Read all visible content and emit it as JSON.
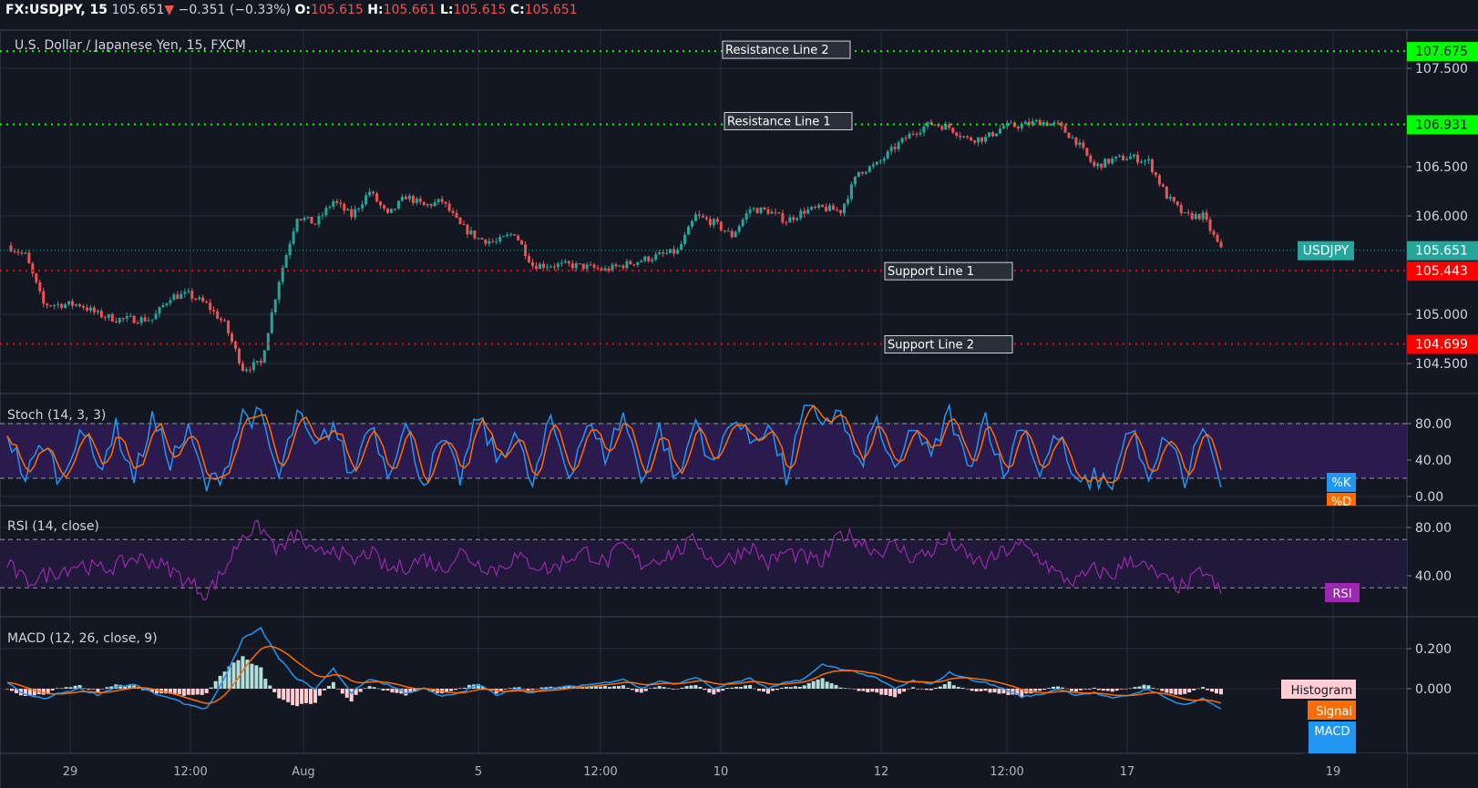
{
  "header": {
    "symbol": "FX:USDJPY, 15",
    "last": "105.651",
    "arrow": "▼",
    "change": "−0.351 (−0.33%)",
    "o_label": "O:",
    "o": "105.615",
    "h_label": "H:",
    "h": "105.661",
    "l_label": "L:",
    "l": "105.615",
    "c_label": "C:",
    "c": "105.651"
  },
  "colors": {
    "bg": "#131722",
    "grid": "#2a2e39",
    "up": "#26a69a",
    "down": "#ef5350",
    "resistance": "#00ff00",
    "support": "#ff0000",
    "k": "#2196f3",
    "d": "#ff6d00",
    "rsi": "#9c27b0"
  },
  "chart_data": {
    "type": "candlestick",
    "title": "U.S. Dollar / Japanese Yen, 15, FXCM",
    "x_ticks": [
      "29",
      "12:00",
      "Aug",
      "5",
      "12:00",
      "10",
      "12",
      "12:00",
      "17",
      "19"
    ],
    "price": {
      "yticks": [
        "107.500",
        "106.500",
        "106.000",
        "105.000",
        "104.500"
      ],
      "ytick_values": [
        107.5,
        106.5,
        106.0,
        105.0,
        104.5
      ],
      "ylim": [
        104.2,
        107.75
      ],
      "closes": [
        105.7,
        105.6,
        105.1,
        105.1,
        105.1,
        105.0,
        104.95,
        104.95,
        104.95,
        105.18,
        105.2,
        105.1,
        104.9,
        104.45,
        104.5,
        105.35,
        106.0,
        105.92,
        106.15,
        106.0,
        106.25,
        106.0,
        106.2,
        106.1,
        106.15,
        105.9,
        105.77,
        105.73,
        105.83,
        105.5,
        105.5,
        105.5,
        105.48,
        105.45,
        105.5,
        105.55,
        105.6,
        105.64,
        106.0,
        105.93,
        105.8,
        106.07,
        106.05,
        105.95,
        106.05,
        106.08,
        106.05,
        106.45,
        106.52,
        106.7,
        106.85,
        106.94,
        106.9,
        106.78,
        106.79,
        106.91,
        106.92,
        106.96,
        106.92,
        106.76,
        106.5,
        106.57,
        106.6,
        106.55,
        106.2,
        106.0,
        106.0,
        105.65
      ],
      "last_label": "USDJPY",
      "last_value": 105.651,
      "last_text": "105.651",
      "lines": [
        {
          "name": "Resistance Line 2",
          "value": 107.675,
          "text": "107.675",
          "kind": "resistance"
        },
        {
          "name": "Resistance Line 1",
          "value": 106.931,
          "text": "106.931",
          "kind": "resistance"
        },
        {
          "name": "Support Line 1",
          "value": 105.443,
          "text": "105.443",
          "kind": "support"
        },
        {
          "name": "Support Line 2",
          "value": 104.699,
          "text": "104.699",
          "kind": "support"
        }
      ]
    },
    "stoch": {
      "title": "Stoch (14, 3, 3)",
      "yticks": [
        "80.00",
        "40.00",
        "0.00"
      ],
      "ytick_values": [
        80,
        40,
        0
      ],
      "band": [
        20,
        80
      ],
      "k_label": "%K",
      "d_label": "%D",
      "k": [
        70,
        20,
        60,
        15,
        80,
        30,
        75,
        20,
        85,
        40,
        70,
        10,
        30,
        90,
        85,
        20,
        90,
        50,
        80,
        20,
        85,
        30,
        75,
        15,
        60,
        20,
        90,
        40,
        70,
        10,
        85,
        25,
        80,
        45,
        90,
        20,
        75,
        15,
        85,
        30,
        90,
        60,
        80,
        20,
        95,
        85,
        90,
        30,
        85,
        20,
        80,
        40,
        95,
        30,
        90,
        20,
        85,
        25,
        70,
        10,
        20,
        15,
        80,
        10,
        70,
        15,
        80,
        10
      ]
    },
    "rsi": {
      "title": "RSI (14, close)",
      "yticks": [
        "80.00",
        "40.00"
      ],
      "ytick_values": [
        80,
        40
      ],
      "band": [
        30,
        70
      ],
      "label": "RSI",
      "values": [
        50,
        35,
        40,
        45,
        50,
        45,
        48,
        55,
        52,
        45,
        35,
        25,
        45,
        75,
        80,
        60,
        75,
        55,
        65,
        50,
        60,
        45,
        48,
        55,
        45,
        60,
        50,
        45,
        55,
        50,
        45,
        55,
        60,
        50,
        65,
        50,
        55,
        60,
        70,
        50,
        55,
        65,
        50,
        60,
        55,
        50,
        75,
        70,
        60,
        65,
        55,
        60,
        70,
        55,
        50,
        60,
        65,
        55,
        40,
        35,
        45,
        40,
        55,
        45,
        35,
        30,
        45,
        25
      ]
    },
    "macd": {
      "title": "MACD (12, 26, close, 9)",
      "yticks": [
        "0.200",
        "0.000"
      ],
      "ytick_values": [
        0.2,
        0
      ],
      "hist_label": "Histogram",
      "signal_label": "Signal",
      "macd_label": "MACD",
      "values": [
        0.03,
        -0.03,
        -0.05,
        -0.02,
        0.0,
        -0.03,
        0.01,
        0.02,
        -0.02,
        -0.05,
        -0.08,
        -0.1,
        0.05,
        0.25,
        0.3,
        0.15,
        0.05,
        0.0,
        0.1,
        -0.02,
        0.05,
        0.02,
        -0.02,
        0.0,
        -0.04,
        -0.02,
        0.02,
        -0.03,
        0.0,
        -0.02,
        0.0,
        0.01,
        0.02,
        0.03,
        0.05,
        0.0,
        0.04,
        0.02,
        0.06,
        0.0,
        0.03,
        0.05,
        0.0,
        0.03,
        0.05,
        0.12,
        0.1,
        0.08,
        0.05,
        0.0,
        0.04,
        0.02,
        0.08,
        0.05,
        0.03,
        0.0,
        -0.04,
        -0.03,
        0.0,
        -0.03,
        -0.02,
        -0.05,
        -0.03,
        0.0,
        -0.05,
        -0.08,
        -0.05,
        -0.1
      ]
    }
  }
}
